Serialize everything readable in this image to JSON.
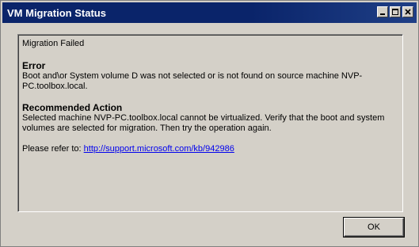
{
  "window": {
    "title": "VM Migration Status",
    "title_bar_color": "#0a246a"
  },
  "title_buttons": {
    "minimize_icon": "minimize-icon",
    "maximize_icon": "maximize-icon",
    "close_icon": "close-icon"
  },
  "content": {
    "status": "Migration Failed",
    "error_heading": "Error",
    "error_line1": "Boot and\\or System volume D was not selected or is not found on source machine NVP-",
    "error_line2": "PC.toolbox.local.",
    "action_heading": "Recommended Action",
    "action_line1": "Selected machine NVP-PC.toolbox.local cannot be virtualized. Verify that the boot and system",
    "action_line2": "volumes are selected for migration. Then try the operation again.",
    "refer_label": "Please refer to:",
    "link_text": "http://support.microsoft.com/kb/942986",
    "link_color": "#0000ee"
  },
  "buttons": {
    "ok_label": "OK"
  }
}
